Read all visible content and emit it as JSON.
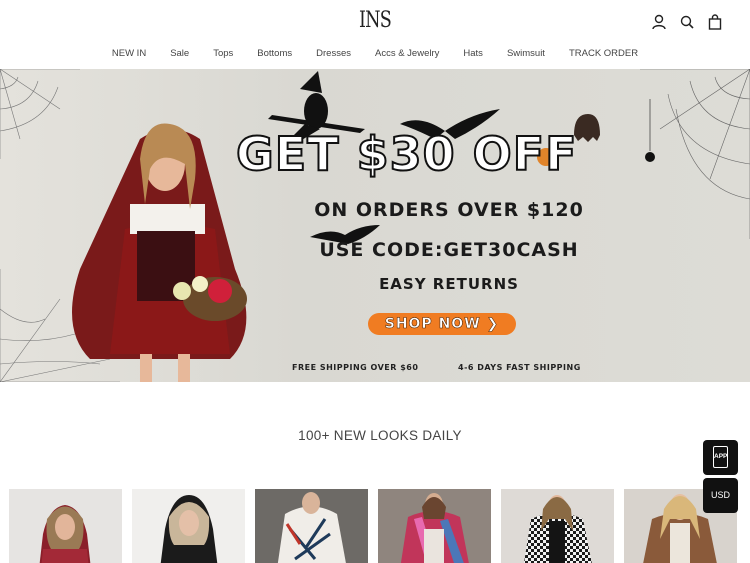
{
  "header": {
    "logo": "INS",
    "icons": [
      "account-icon",
      "search-icon",
      "cart-icon"
    ]
  },
  "nav": {
    "items": [
      "NEW IN",
      "Sale",
      "Tops",
      "Bottoms",
      "Dresses",
      "Accs & Jewelry",
      "Hats",
      "Swimsuit",
      "TRACK ORDER"
    ]
  },
  "banner": {
    "headline": "GET $30 OFF",
    "line1": "ON ORDERS OVER $120",
    "line2": "USE CODE:GET30CASH",
    "line3": "EASY RETURNS",
    "cta": "SHOP NOW ❯",
    "shipping1": "FREE SHIPPING OVER $60",
    "shipping2": "4-6 DAYS FAST SHIPPING",
    "accent_color": "#f07c22"
  },
  "section": {
    "title": "100+ NEW LOOKS DAILY"
  },
  "floating": {
    "app_label": "APP",
    "currency_label": "USD"
  }
}
